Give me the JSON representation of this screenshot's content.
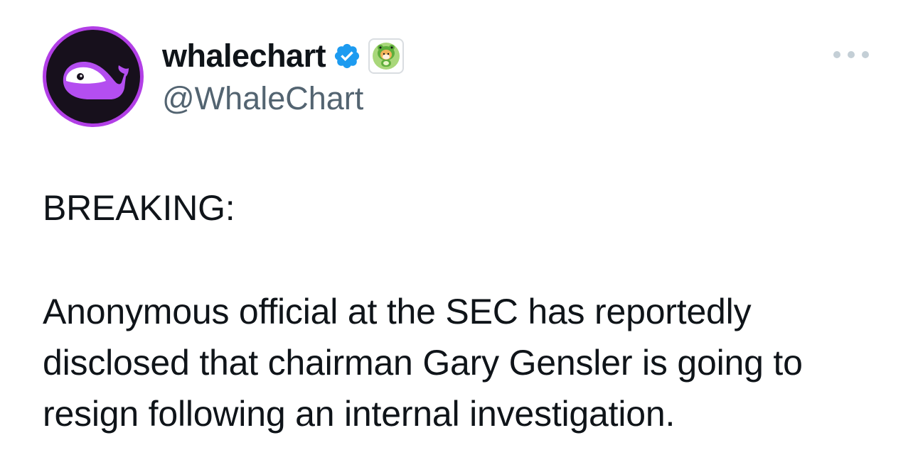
{
  "tweet": {
    "author": {
      "display_name": "whalechart",
      "handle": "@WhaleChart",
      "avatar_icon": "purple-whale-logo",
      "verified_icon": "verified-badge-icon",
      "affiliate_icon": "shiba-frog-badge-icon"
    },
    "headline": "BREAKING:",
    "body": "Anonymous official at the SEC has reportedly\ndisclosed that chairman Gary Gensler is going to\nresign following an internal investigation.",
    "more_icon": "more-options-icon"
  },
  "colors": {
    "verified_blue": "#1d9bf0",
    "handle_gray": "#536471",
    "text_dark": "#0f1419",
    "avatar_ring": "#b23fe6"
  }
}
